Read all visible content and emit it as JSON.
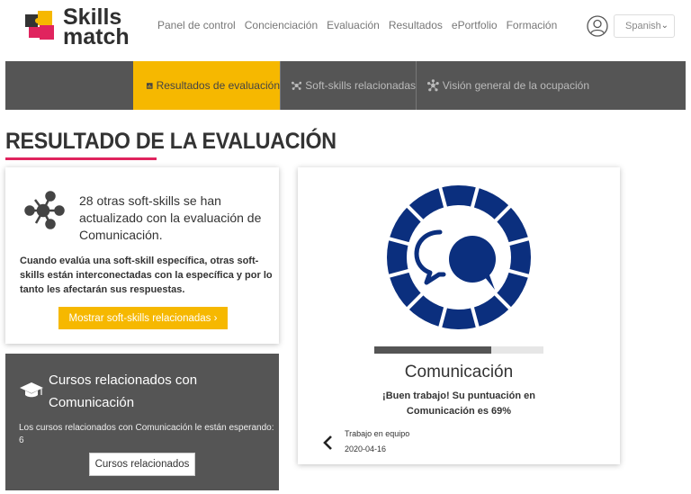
{
  "brand": {
    "line1": "Skills",
    "line2": "match"
  },
  "nav": {
    "items": [
      "Panel de control",
      "Concienciación",
      "Evaluación",
      "Resultados",
      "ePortfolio",
      "Formación"
    ]
  },
  "language": {
    "selected": "Spanish"
  },
  "tabs": [
    {
      "label": "Resultados de evaluación",
      "icon": "bar-chart-icon",
      "active": true
    },
    {
      "label": "Soft-skills relacionadas",
      "icon": "network-icon",
      "active": false
    },
    {
      "label": "Visión general de la ocupación",
      "icon": "network-icon",
      "active": false
    }
  ],
  "page": {
    "title": "RESULTADO DE LA EVALUACIÓN"
  },
  "related_card": {
    "headline": "28 otras soft-skills se han actualizado con la evaluación de Comunicación.",
    "body": "Cuando evalúa una soft-skill específica, otras soft-skills están interconectadas con la específica y por lo tanto les afectarán sus respuestas.",
    "button": "Mostrar soft-skills relacionadas  ›"
  },
  "courses_card": {
    "heading": "Cursos relacionados con Comunicación",
    "body": "Los cursos relacionados con Comunicación le están esperando: 6",
    "button": "Cursos relacionados"
  },
  "result": {
    "skill": "Comunicación",
    "score_percent": 69,
    "message": "¡Buen trabajo! Su puntuación en Comunicación es 69%",
    "previous_skill": "Trabajo en equipo",
    "previous_date": "2020-04-16"
  },
  "colors": {
    "accent_yellow": "#f6b800",
    "dark_gray": "#555555",
    "navy": "#0b2f7e",
    "underline_pink": "#e0245e"
  }
}
